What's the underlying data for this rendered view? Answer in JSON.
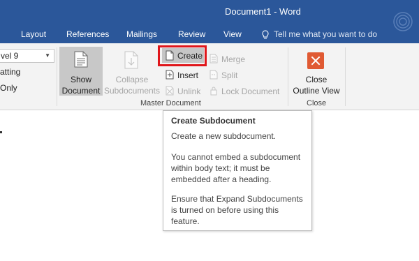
{
  "window": {
    "title": "Document1 - Word"
  },
  "tabs": [
    "Layout",
    "References",
    "Mailings",
    "Review",
    "View"
  ],
  "tell_me": {
    "placeholder": "Tell me what you want to do"
  },
  "outline_tools": {
    "level_value": "vel 9",
    "show_formatting": "atting",
    "first_line_only": "Only"
  },
  "master_document": {
    "show_document": [
      "Show",
      "Document"
    ],
    "collapse_subdocuments": [
      "Collapse",
      "Subdocuments"
    ],
    "create": "Create",
    "insert": "Insert",
    "unlink": "Unlink",
    "merge": "Merge",
    "split": "Split",
    "lock_document": "Lock Document",
    "group_label": "Master Document"
  },
  "close_group": {
    "close_outline_view": [
      "Close",
      "Outline View"
    ],
    "group_label": "Close"
  },
  "tooltip": {
    "title": "Create Subdocument",
    "lines": [
      "Create a new subdocument.",
      "You cannot embed a subdocument",
      "within body text; it must be",
      "embedded after a heading.",
      "Ensure that Expand Subdocuments",
      "is turned on before using this",
      "feature."
    ]
  },
  "colors": {
    "title_bar": "#2b579a",
    "ribbon": "#f3f3f3",
    "highlight": "#e0161b",
    "close_icon": "#e05a33"
  }
}
